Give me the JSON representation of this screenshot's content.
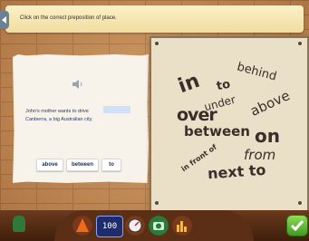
{
  "instruction": "Click on the correct preposition of place.",
  "question": {
    "sentence_line1": "John's mother wants to drive",
    "sentence_line2": "Canberra, a big Australian city."
  },
  "choices": [
    "above",
    "between",
    "to"
  ],
  "word_board": {
    "words": [
      "in",
      "to",
      "behind",
      "under",
      "above",
      "over",
      "between",
      "on",
      "in front of",
      "from",
      "next to"
    ]
  },
  "toolbar": {
    "display_value": "100"
  },
  "colors": {
    "banner": "#fbf0c6",
    "answer_blank": "#cfe0f8",
    "choice_text": "#1c2a5c",
    "check_button": "#3f9a1e"
  }
}
